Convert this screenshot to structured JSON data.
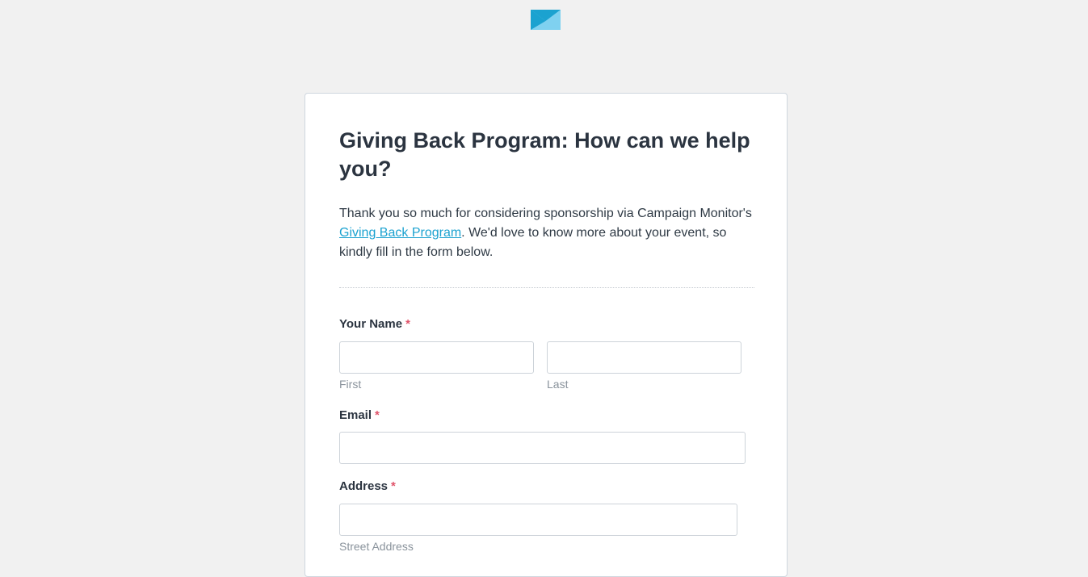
{
  "brand": {
    "logo_icon": "campaign-monitor-envelope-icon",
    "colors": {
      "logo_light": "#7fd1f0",
      "logo_dark": "#1ba2d0"
    }
  },
  "form": {
    "title": "Giving Back Program: How can we help you?",
    "intro_before": "Thank you so much for considering sponsorship via Campaign Monitor's ",
    "intro_link": "Giving Back Program",
    "intro_after": ". We'd love to know more about your event, so kindly fill in the form below.",
    "required_marker": "*",
    "fields": {
      "name": {
        "label": "Your Name",
        "first_value": "",
        "last_value": "",
        "first_sublabel": "First",
        "last_sublabel": "Last"
      },
      "email": {
        "label": "Email",
        "value": ""
      },
      "address": {
        "label": "Address",
        "street_value": "",
        "street_sublabel": "Street Address"
      }
    }
  }
}
